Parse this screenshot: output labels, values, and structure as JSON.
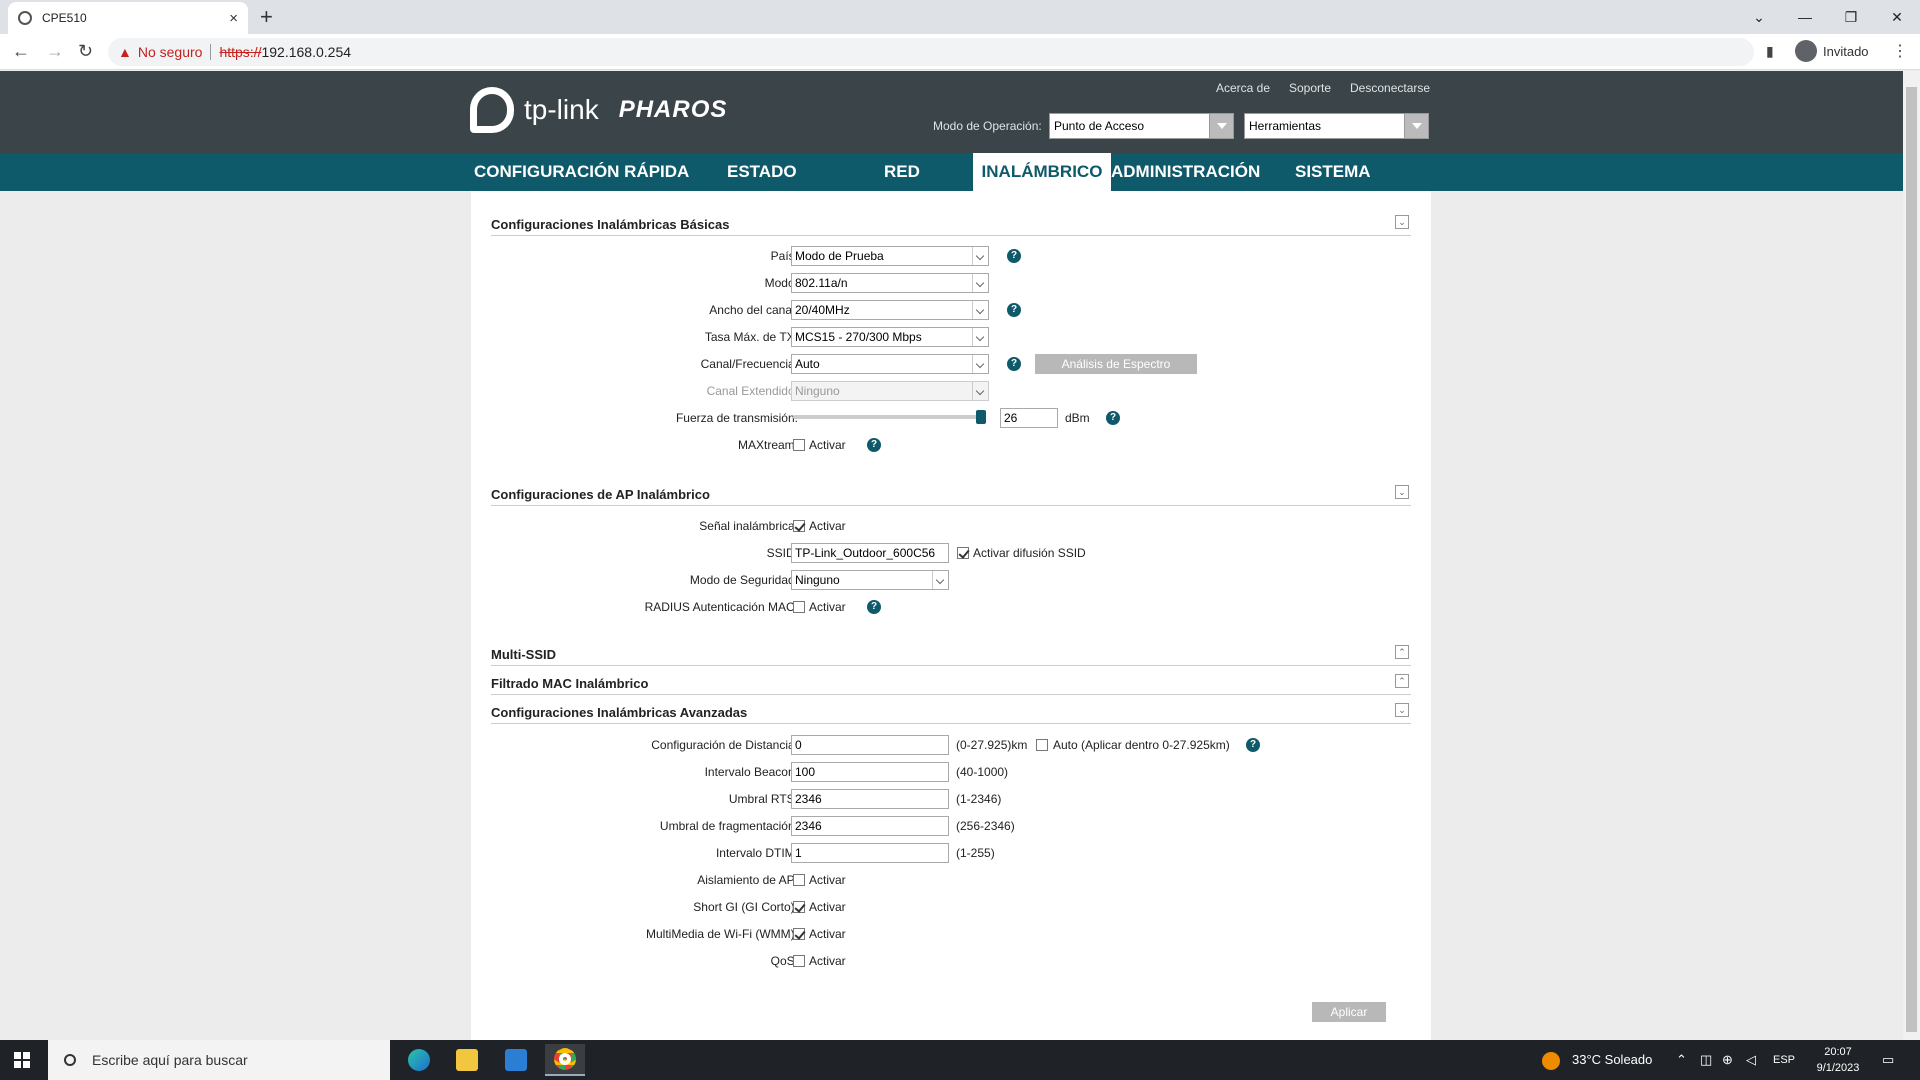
{
  "browser": {
    "tab_title": "CPE510",
    "new_tab": "+",
    "close_tab": "×",
    "security_label": "No seguro",
    "url_scheme": "https://",
    "url_host": "192.168.0.254",
    "profile_name": "Invitado"
  },
  "header": {
    "brand": "tp-link",
    "product": "PHAROS",
    "links": [
      "Acerca de",
      "Soporte",
      "Desconectarse"
    ],
    "op_mode_label": "Modo de Operación:",
    "op_mode_value": "Punto de Acceso",
    "tools_value": "Herramientas"
  },
  "nav": {
    "items": [
      "CONFIGURACIÓN RÁPIDA",
      "ESTADO",
      "RED",
      "INALÁMBRICO",
      "ADMINISTRACIÓN",
      "SISTEMA"
    ],
    "active": "INALÁMBRICO"
  },
  "basic": {
    "title": "Configuraciones Inalámbricas Básicas",
    "pais_label": "País:",
    "pais_value": "Modo de Prueba",
    "modo_label": "Modo:",
    "modo_value": "802.11a/n",
    "ancho_label": "Ancho del canal:",
    "ancho_value": "20/40MHz",
    "tasa_label": "Tasa Máx. de TX:",
    "tasa_value": "MCS15 - 270/300 Mbps",
    "canal_label": "Canal/Frecuencia:",
    "canal_value": "Auto",
    "spectrum_button": "Análisis de Espectro",
    "ext_label": "Canal Extendido:",
    "ext_value": "Ninguno",
    "power_label": "Fuerza de transmisión:",
    "power_value": "26",
    "power_unit": "dBm",
    "power_fraction": 1.0,
    "maxtream_label": "MAXtream:",
    "maxtream_check": "Activar",
    "maxtream_on": false
  },
  "ap": {
    "title": "Configuraciones de AP Inalámbrico",
    "signal_label": "Señal inalámbrica:",
    "signal_check": "Activar",
    "signal_on": true,
    "ssid_label": "SSID:",
    "ssid_value": "TP-Link_Outdoor_600C56",
    "broadcast_check": "Activar difusión SSID",
    "broadcast_on": true,
    "security_label": "Modo de Seguridad:",
    "security_value": "Ninguno",
    "radius_label": "RADIUS Autenticación MAC:",
    "radius_check": "Activar",
    "radius_on": false
  },
  "collapsed": {
    "multi_ssid": "Multi-SSID",
    "mac_filter": "Filtrado MAC Inalámbrico"
  },
  "advanced": {
    "title": "Configuraciones Inalámbricas Avanzadas",
    "distance_label": "Configuración de Distancia:",
    "distance_value": "0",
    "distance_hint": "(0-27.925)km",
    "auto_check": "Auto (Aplicar dentro 0-27.925km)",
    "auto_on": false,
    "beacon_label": "Intervalo Beacon:",
    "beacon_value": "100",
    "beacon_hint": "(40-1000)",
    "rts_label": "Umbral RTS:",
    "rts_value": "2346",
    "rts_hint": "(1-2346)",
    "frag_label": "Umbral de fragmentación:",
    "frag_value": "2346",
    "frag_hint": "(256-2346)",
    "dtim_label": "Intervalo DTIM:",
    "dtim_value": "1",
    "dtim_hint": "(1-255)",
    "isolation_label": "Aislamiento de AP:",
    "isolation_check": "Activar",
    "isolation_on": false,
    "shortgi_label": "Short GI (GI Corto):",
    "shortgi_check": "Activar",
    "shortgi_on": true,
    "wmm_label": "MultiMedia de Wi-Fi (WMM):",
    "wmm_check": "Activar",
    "wmm_on": true,
    "qos_label": "QoS:",
    "qos_check": "Activar",
    "qos_on": false,
    "apply_button": "Aplicar"
  },
  "taskbar": {
    "search_placeholder": "Escribe aquí para buscar",
    "weather": "33°C  Soleado",
    "language": "ESP",
    "time": "20:07",
    "date": "9/1/2023"
  },
  "colors": {
    "header_bg": "#3b4448",
    "nav_bg": "#0e5a6a",
    "accent": "#0e5a6a"
  }
}
